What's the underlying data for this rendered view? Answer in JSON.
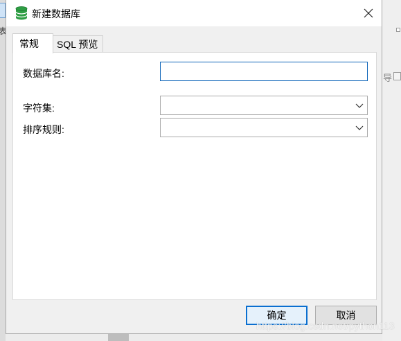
{
  "dialog": {
    "title": "新建数据库",
    "icon": "database-icon",
    "close_glyph": "✕"
  },
  "tabs": [
    {
      "label": "常规",
      "active": true
    },
    {
      "label": "SQL 预览",
      "active": false
    }
  ],
  "form": {
    "name_label": "数据库名:",
    "name_value": "",
    "charset_label": "字符集:",
    "charset_value": "",
    "collation_label": "排序规则:",
    "collation_value": ""
  },
  "buttons": {
    "ok_label": "确定",
    "cancel_label": "取消"
  },
  "background": {
    "left_char": "表",
    "right_char": "导"
  },
  "watermark": "https://blog.csdn.net/python113",
  "colors": {
    "accent": "#0a63b8",
    "db_icon": "#2e9e44",
    "panel_bg": "#ffffff",
    "dialog_bg": "#f0f0f0"
  }
}
